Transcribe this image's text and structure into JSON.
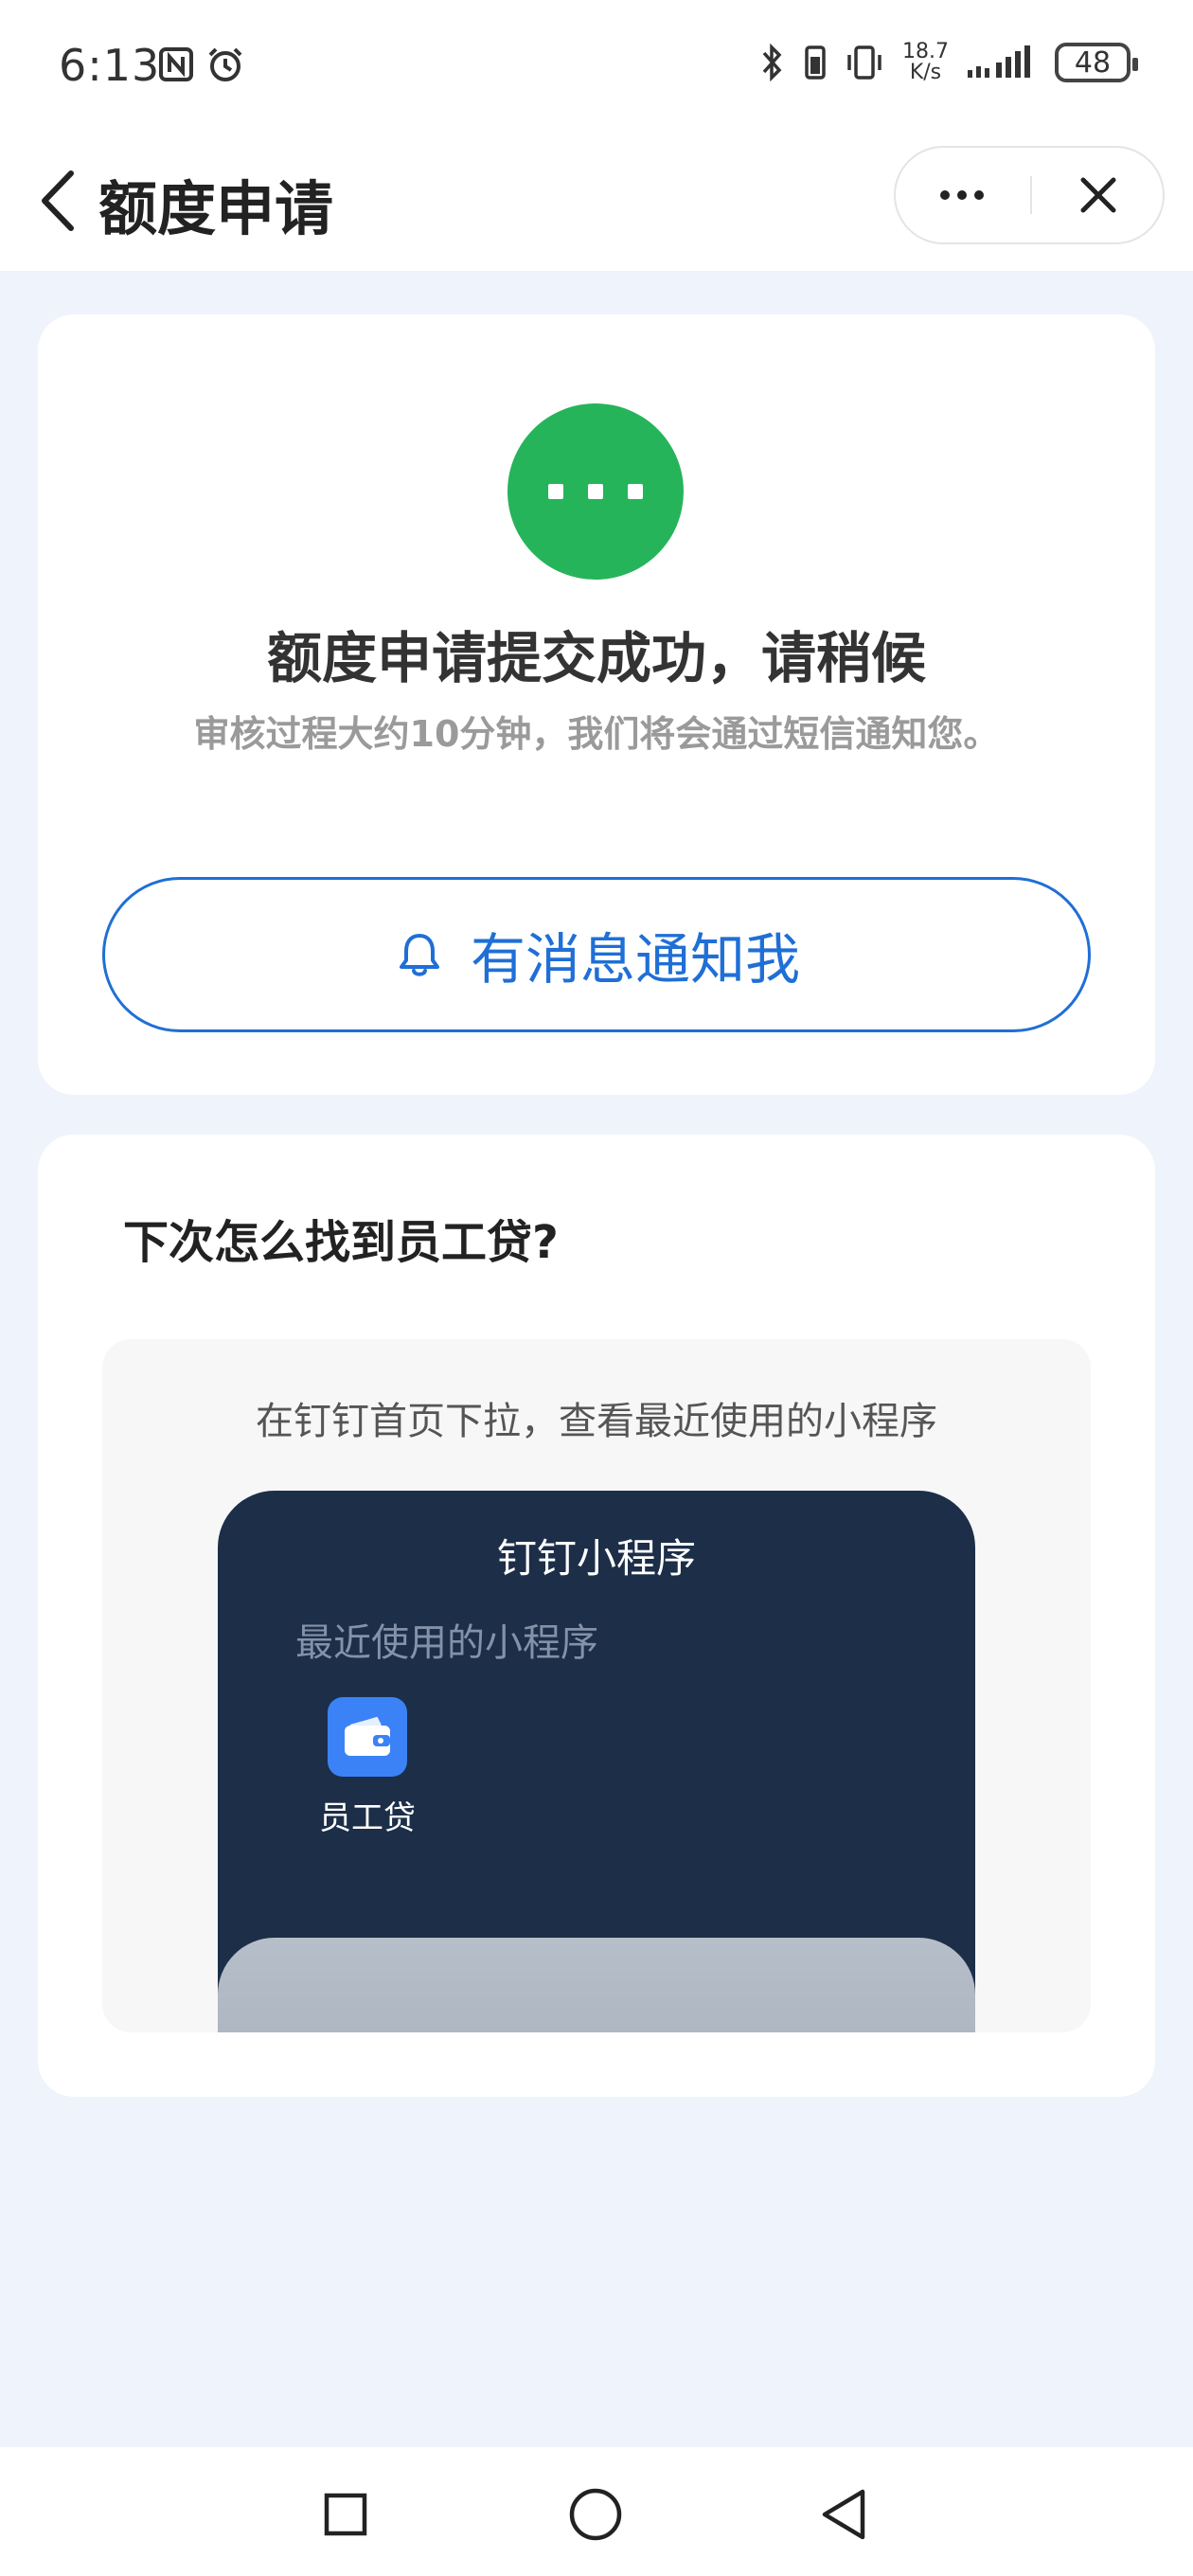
{
  "status_bar": {
    "time": "6:13",
    "net_speed_value": "18.7",
    "net_speed_unit": "K/s",
    "battery": "48",
    "icons": [
      "nfc-icon",
      "alarm-icon",
      "bluetooth-icon",
      "battery-saver-icon",
      "vibrate-icon",
      "signal-icon"
    ]
  },
  "nav": {
    "title": "额度申请",
    "icons": [
      "back-arrow-icon",
      "more-icon",
      "close-icon"
    ]
  },
  "result": {
    "title": "额度申请提交成功，请稍候",
    "subtitle": "审核过程大约10分钟，我们将会通过短信通知您。",
    "notify_button": "有消息通知我",
    "status_color": "#26b45a",
    "accent_color": "#1f6fd6"
  },
  "guide": {
    "title": "下次怎么找到员工贷?",
    "instruction": "在钉钉首页下拉，查看最近使用的小程序",
    "mock": {
      "title": "钉钉小程序",
      "recent_label": "最近使用的小程序",
      "app_label": "员工贷",
      "app_icon": "wallet-icon"
    }
  },
  "system_nav": {
    "icons": [
      "recent-apps-icon",
      "home-icon",
      "back-icon"
    ]
  }
}
